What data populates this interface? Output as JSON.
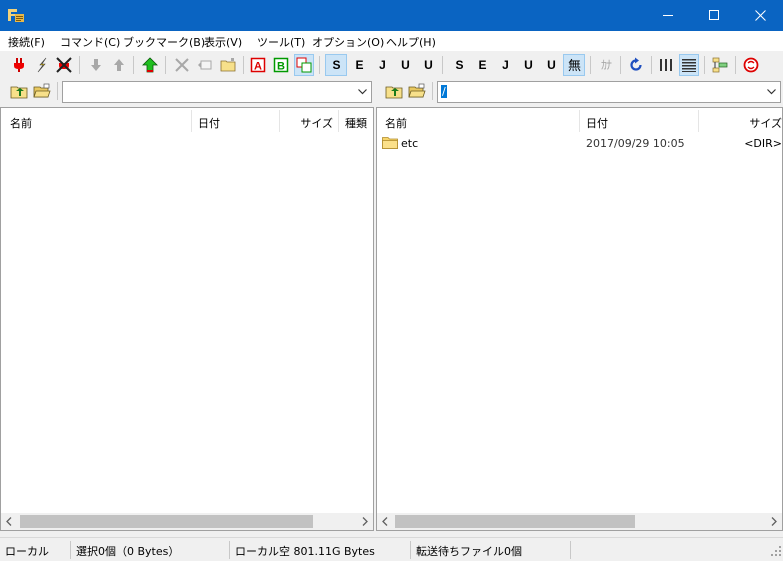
{
  "window": {
    "title": "",
    "colors": {
      "titlebar": "#0a64c2",
      "selected_tool": "#cce4f7",
      "scroll_thumb": "#c2c2c2"
    }
  },
  "menu": [
    {
      "label": "接続(F)"
    },
    {
      "label": "コマンド(C)"
    },
    {
      "label": "ブックマーク(B)"
    },
    {
      "label": "表示(V)"
    },
    {
      "label": "ツール(T)"
    },
    {
      "label": "オプション(O)"
    },
    {
      "label": "ヘルプ(H)"
    }
  ],
  "toolbar": {
    "kanji_modes": [
      {
        "name": "sjis",
        "label": "S"
      },
      {
        "name": "euc",
        "label": "E"
      },
      {
        "name": "jis",
        "label": "J"
      },
      {
        "name": "utf8",
        "label": "U"
      },
      {
        "name": "utf8-bom",
        "label": "U"
      }
    ],
    "no_convert_label": "無",
    "kana_label": "ｶﾅ",
    "icons": [
      "connect-icon",
      "quick-connect-icon",
      "disconnect-icon",
      "download-icon",
      "upload-icon",
      "mirror-upload-icon",
      "delete-icon",
      "rename-icon",
      "mkdir-icon",
      "ascii-mode-icon",
      "binary-mode-icon",
      "auto-mode-icon",
      "refresh-icon",
      "list-view-icon",
      "detail-view-icon",
      "compare-icon",
      "stop-icon"
    ]
  },
  "local": {
    "path": "",
    "columns": [
      "名前",
      "日付",
      "サイズ",
      "種類"
    ],
    "files": []
  },
  "remote": {
    "path": "/",
    "columns": [
      "名前",
      "日付",
      "サイズ"
    ],
    "files": [
      {
        "name": "etc",
        "date": "2017/09/29 10:05",
        "size": "<DIR>",
        "icon": "folder-icon"
      }
    ]
  },
  "status": {
    "mode": "ローカル",
    "selection": "選択0個（0 Bytes）",
    "free_space": "ローカル空 801.11G Bytes",
    "queue": "転送待ちファイル0個"
  }
}
